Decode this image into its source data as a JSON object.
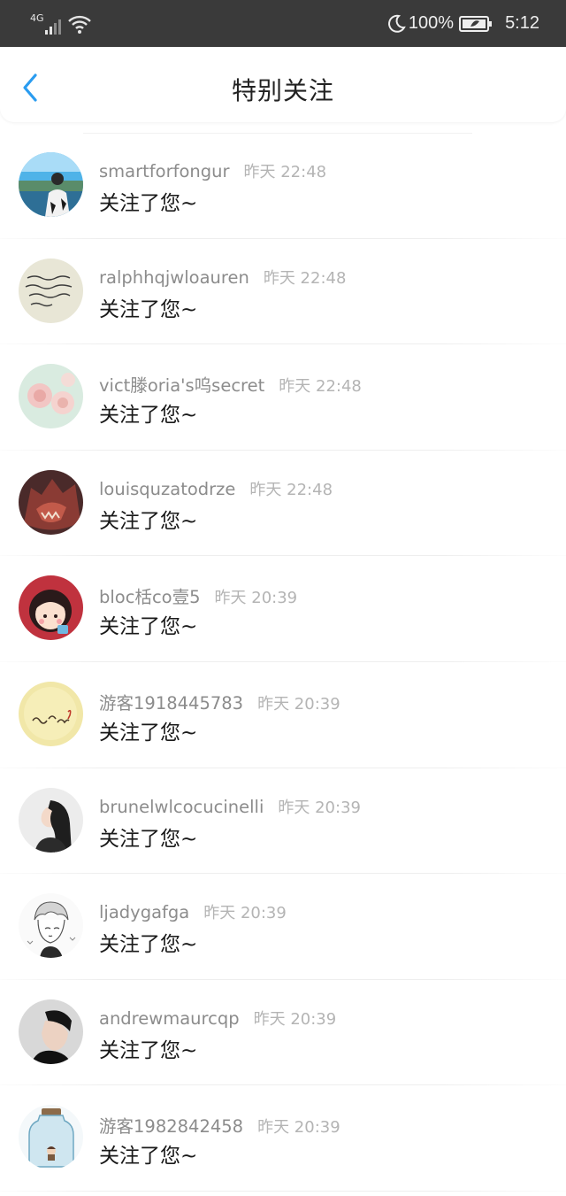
{
  "status_bar": {
    "network": "4G",
    "battery": "100%",
    "time": "5:12",
    "icons": [
      "signal-icon",
      "wifi-icon",
      "moon-icon",
      "battery-icon"
    ]
  },
  "header": {
    "title": "特别关注",
    "back_icon": "chevron-left-icon",
    "accent": "#2a9cf0"
  },
  "notifications": [
    {
      "name": "smartforfongur",
      "time": "昨天 22:48",
      "message": "关注了您~",
      "avatar": "avatar-photo-lake"
    },
    {
      "name": "ralphhqjwloauren",
      "time": "昨天 22:48",
      "message": "关注了您~",
      "avatar": "avatar-handwriting"
    },
    {
      "name": "vict滕oria's呜secret",
      "time": "昨天 22:48",
      "message": "关注了您~",
      "avatar": "avatar-roses"
    },
    {
      "name": "louisquzatodrze",
      "time": "昨天 22:48",
      "message": "关注了您~",
      "avatar": "avatar-wolf"
    },
    {
      "name": "bloc栝co壹5",
      "time": "昨天 20:39",
      "message": "关注了您~",
      "avatar": "avatar-cartoon-girl"
    },
    {
      "name": "游客1918445783",
      "time": "昨天 20:39",
      "message": "关注了您~",
      "avatar": "avatar-yellow-text"
    },
    {
      "name": "brunelwlcocucinelli",
      "time": "昨天 20:39",
      "message": "关注了您~",
      "avatar": "avatar-woman-profile"
    },
    {
      "name": "ljadygafga",
      "time": "昨天 20:39",
      "message": "关注了您~",
      "avatar": "avatar-sketch-boy"
    },
    {
      "name": "andrewmaurcqp",
      "time": "昨天 20:39",
      "message": "关注了您~",
      "avatar": "avatar-man-profile"
    },
    {
      "name": "游客1982842458",
      "time": "昨天 20:39",
      "message": "关注了您~",
      "avatar": "avatar-jar"
    }
  ]
}
